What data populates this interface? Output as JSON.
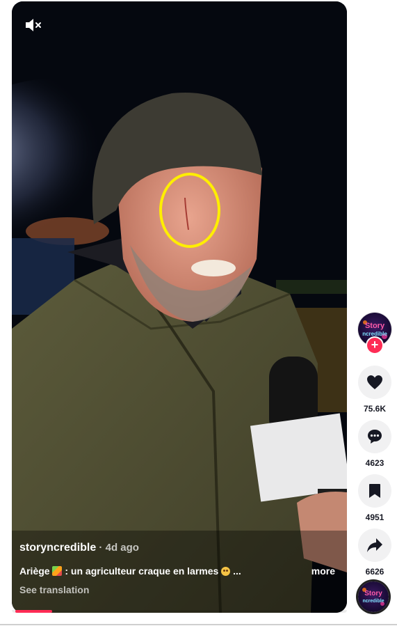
{
  "video": {
    "mute_icon": "speaker-muted-icon",
    "progress": 0.11
  },
  "caption": {
    "username": "storyncredible",
    "separator": " · ",
    "age": "4d ago",
    "desc_start": "Ariège ",
    "desc_mid": " : un agriculteur craque en larmes ",
    "desc_end": " ...",
    "more": "more",
    "see_translation": "See translation"
  },
  "sidebar": {
    "avatar_text_top": "Story",
    "avatar_text_bottom": "ncredible",
    "follow": "+",
    "like_count": "75.6K",
    "comment_count": "4623",
    "save_count": "4951",
    "share_count": "6626",
    "icons": [
      "heart-icon",
      "comment-icon",
      "bookmark-icon",
      "share-icon"
    ]
  },
  "colors": {
    "accent": "#fe2c55",
    "highlight_circle": "#ffee00"
  }
}
